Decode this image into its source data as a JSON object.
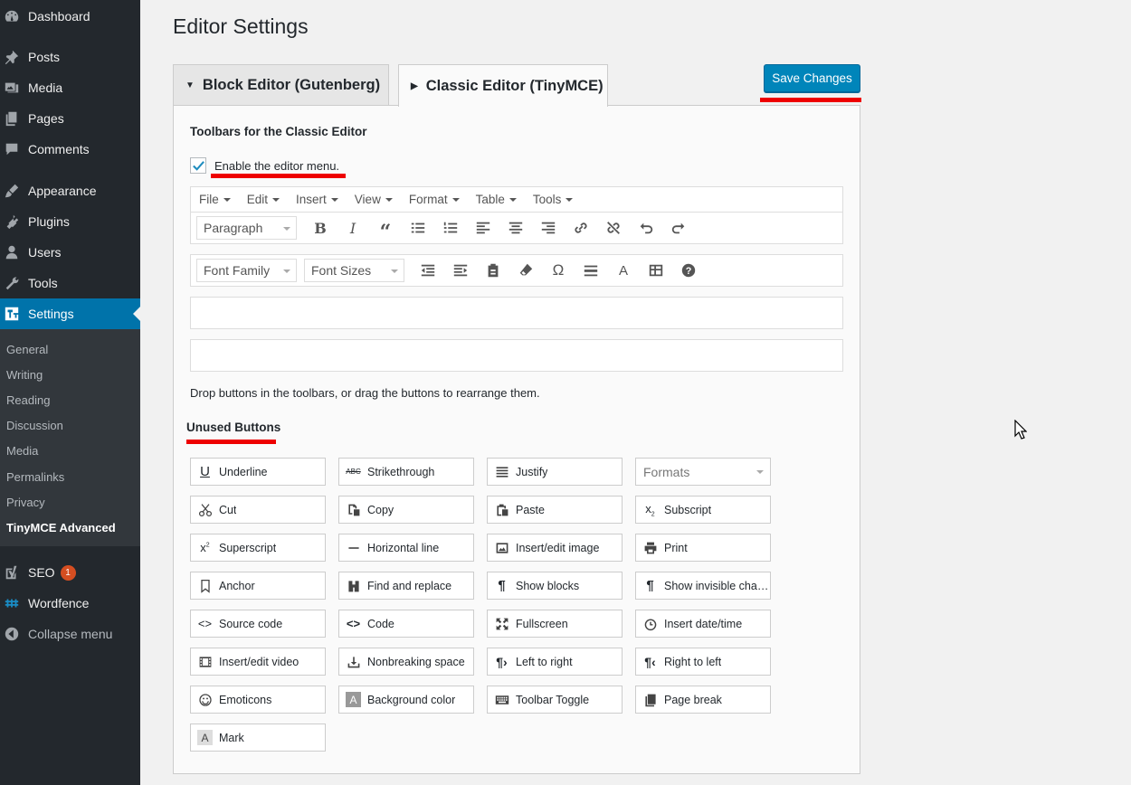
{
  "sidebar": {
    "top_items": [
      {
        "label": "Dashboard",
        "icon": "dashboard-icon"
      },
      {
        "label": "Posts",
        "icon": "pin-icon"
      },
      {
        "label": "Media",
        "icon": "media-icon"
      },
      {
        "label": "Pages",
        "icon": "pages-icon"
      },
      {
        "label": "Comments",
        "icon": "comment-icon"
      },
      {
        "label": "Appearance",
        "icon": "brush-icon"
      },
      {
        "label": "Plugins",
        "icon": "plug-icon"
      },
      {
        "label": "Users",
        "icon": "user-icon"
      },
      {
        "label": "Tools",
        "icon": "wrench-icon"
      },
      {
        "label": "Settings",
        "icon": "settings-icon"
      }
    ],
    "submenu": [
      "General",
      "Writing",
      "Reading",
      "Discussion",
      "Media",
      "Permalinks",
      "Privacy",
      "TinyMCE Advanced"
    ],
    "bottom_items": [
      {
        "label": "SEO",
        "icon": "yoast-icon",
        "badge": "1"
      },
      {
        "label": "Wordfence",
        "icon": "wordfence-icon"
      },
      {
        "label": "Collapse menu",
        "icon": "collapse-icon"
      }
    ]
  },
  "main": {
    "title": "Editor Settings",
    "tabs": [
      "Block Editor (Gutenberg)",
      "Classic Editor (TinyMCE)"
    ],
    "save_label": "Save Changes",
    "toolbars_heading": "Toolbars for the Classic Editor",
    "enable_menu_label": "Enable the editor menu.",
    "enable_menu_checked": true,
    "menubar": [
      "File",
      "Edit",
      "Insert",
      "View",
      "Format",
      "Table",
      "Tools"
    ],
    "toolbar1_select": "Paragraph",
    "toolbar2_selects": [
      "Font Family",
      "Font Sizes"
    ],
    "drop_text": "Drop buttons in the toolbars, or drag the buttons to rearrange them.",
    "unused_heading": "Unused Buttons",
    "unused_buttons": [
      "Underline",
      "Strikethrough",
      "Justify",
      "Formats",
      "Cut",
      "Copy",
      "Paste",
      "Subscript",
      "Superscript",
      "Horizontal line",
      "Insert/edit image",
      "Print",
      "Anchor",
      "Find and replace",
      "Show blocks",
      "Show invisible chara...",
      "Source code",
      "Code",
      "Fullscreen",
      "Insert date/time",
      "Insert/edit video",
      "Nonbreaking space",
      "Left to right",
      "Right to left",
      "Emoticons",
      "Background color",
      "Toolbar Toggle",
      "Page break",
      "Mark"
    ]
  },
  "colors": {
    "accent": "#0073aa",
    "save_button": "#0085ba",
    "highlight": "#e00000",
    "sidebar": "#23282d"
  }
}
